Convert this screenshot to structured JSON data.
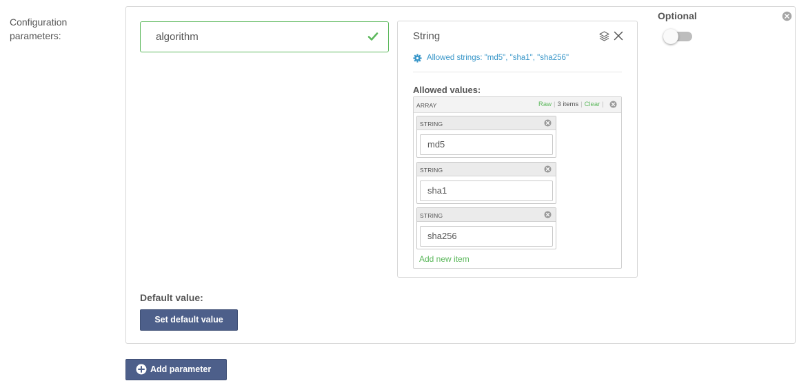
{
  "section": {
    "label": "Configuration parameters:"
  },
  "parameter": {
    "name_value": "algorithm",
    "type_title": "String",
    "hint": "Allowed strings: \"md5\", \"sha1\", \"sha256\"",
    "allowed_label": "Allowed values:",
    "array": {
      "type_label": "ARRAY",
      "raw_label": "Raw",
      "count_label": "3 items",
      "clear_label": "Clear",
      "items": [
        {
          "type_label": "STRING",
          "value": "md5"
        },
        {
          "type_label": "STRING",
          "value": "sha1"
        },
        {
          "type_label": "STRING",
          "value": "sha256"
        }
      ],
      "add_item_label": "Add new item"
    },
    "optional_label": "Optional",
    "optional_enabled": false,
    "default_label": "Default value:",
    "set_default_label": "Set default value"
  },
  "footer": {
    "add_parameter_label": "Add parameter"
  },
  "colors": {
    "accent": "#4d5f8a",
    "success": "#5cb85c",
    "info": "#3a97c9"
  },
  "icons": [
    "check-icon",
    "layers-icon",
    "close-icon",
    "gear-icon",
    "close-circle-icon",
    "plus-circle-icon"
  ]
}
